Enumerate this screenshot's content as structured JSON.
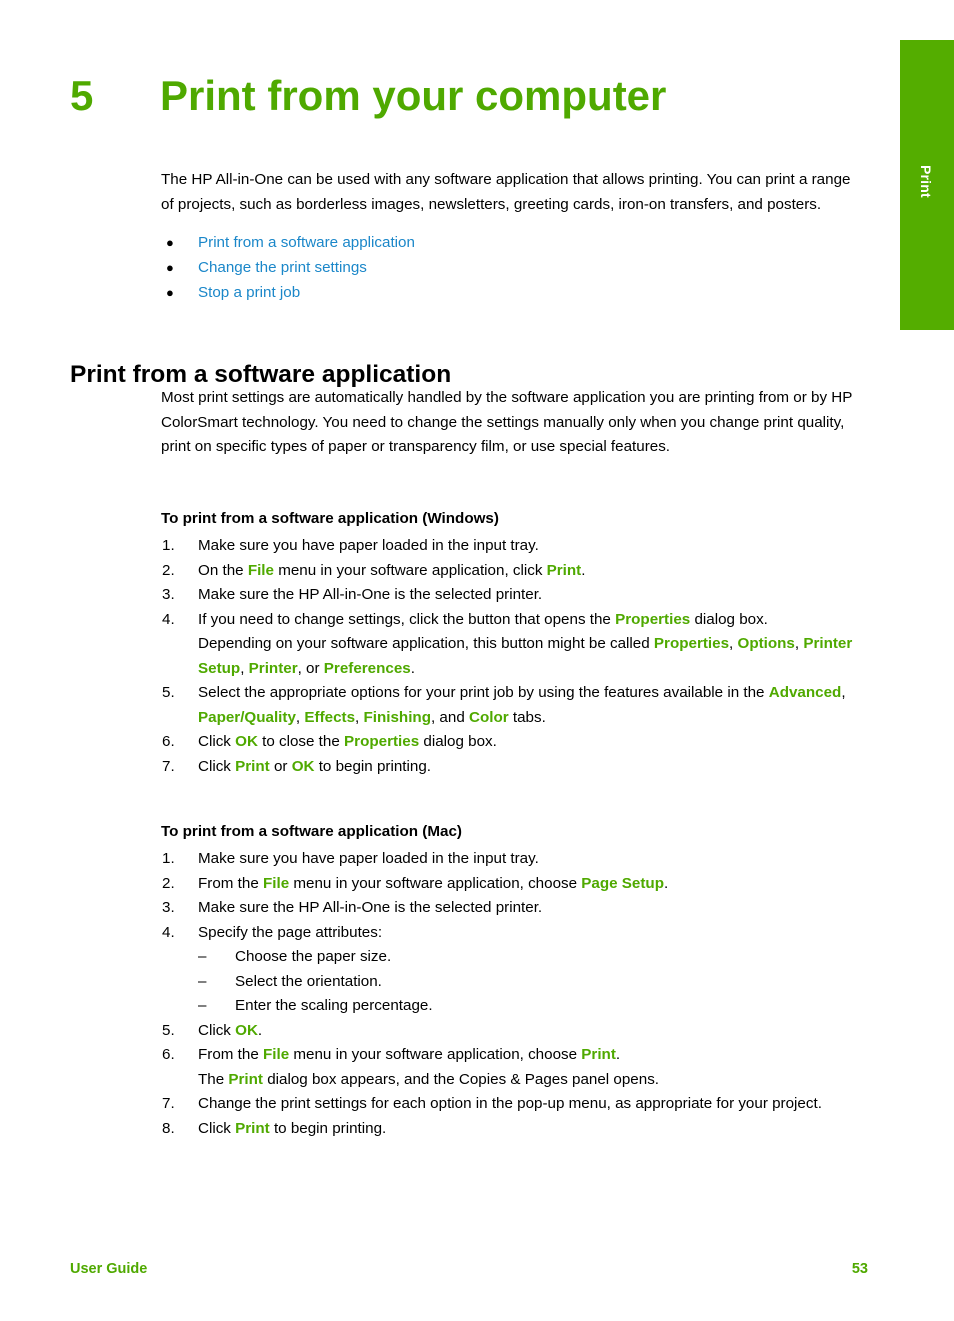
{
  "colors": {
    "accent_green": "#4fa900",
    "tab_green": "#54ad00",
    "link_blue": "#1b87c9",
    "text_black": "#000000"
  },
  "side_tab": {
    "label": "Print"
  },
  "chapter": {
    "number": "5",
    "title": "Print from your computer"
  },
  "intro": {
    "paragraph": "The HP All-in-One can be used with any software application that allows printing. You can print a range of projects, such as borderless images, newsletters, greeting cards, iron-on transfers, and posters.",
    "links": [
      {
        "label": "Print from a software application",
        "bullet": "●"
      },
      {
        "label": "Change the print settings",
        "bullet": "●"
      },
      {
        "label": "Stop a print job",
        "bullet": "●"
      }
    ]
  },
  "section": {
    "heading": "Print from a software application",
    "paragraph": "Most print settings are automatically handled by the software application you are printing from or by HP ColorSmart technology. You need to change the settings manually only when you change print quality, print on specific types of paper or transparency film, or use special features."
  },
  "windows_procedure": {
    "title": "To print from a software application (Windows)",
    "steps": [
      {
        "marker": "1.",
        "text": "Make sure you have paper loaded in the input tray."
      },
      {
        "marker": "2.",
        "text": "On the File menu in your software application, click Print."
      },
      {
        "marker": "3.",
        "text": "Make sure the HP All-in-One is the selected printer."
      },
      {
        "marker": "4.",
        "text": "If you need to change settings, click the button that opens the Properties dialog box.",
        "continuation": "Depending on your software application, this button might be called Properties, Options, Printer Setup, Printer, or Preferences."
      },
      {
        "marker": "5.",
        "text": "Select the appropriate options for your print job by using the features available in the Advanced, Paper/Quality, Effects, Finishing, and Color tabs."
      },
      {
        "marker": "6.",
        "text": "Click OK to close the Properties dialog box."
      },
      {
        "marker": "7.",
        "text": "Click Print or OK to begin printing."
      }
    ]
  },
  "mac_procedure": {
    "title": "To print from a software application (Mac)",
    "steps": [
      {
        "marker": "1.",
        "text": "Make sure you have paper loaded in the input tray."
      },
      {
        "marker": "2.",
        "text": "From the File menu in your software application, choose Page Setup."
      },
      {
        "marker": "3.",
        "text": "Make sure the HP All-in-One is the selected printer."
      },
      {
        "marker": "4.",
        "text": "Specify the page attributes:",
        "sub_items": [
          {
            "dash": "–",
            "text": "Choose the paper size."
          },
          {
            "dash": "–",
            "text": "Select the orientation."
          },
          {
            "dash": "–",
            "text": "Enter the scaling percentage."
          }
        ]
      },
      {
        "marker": "5.",
        "text": "Click OK."
      },
      {
        "marker": "6.",
        "text": "From the File menu in your software application, choose Print.",
        "continuation": "The Print dialog box appears, and the Copies & Pages panel opens."
      },
      {
        "marker": "7.",
        "text": "Change the print settings for each option in the pop-up menu, as appropriate for your project."
      },
      {
        "marker": "8.",
        "text": "Click Print to begin printing."
      }
    ]
  },
  "footer": {
    "left": "User Guide",
    "page_number": "53"
  }
}
